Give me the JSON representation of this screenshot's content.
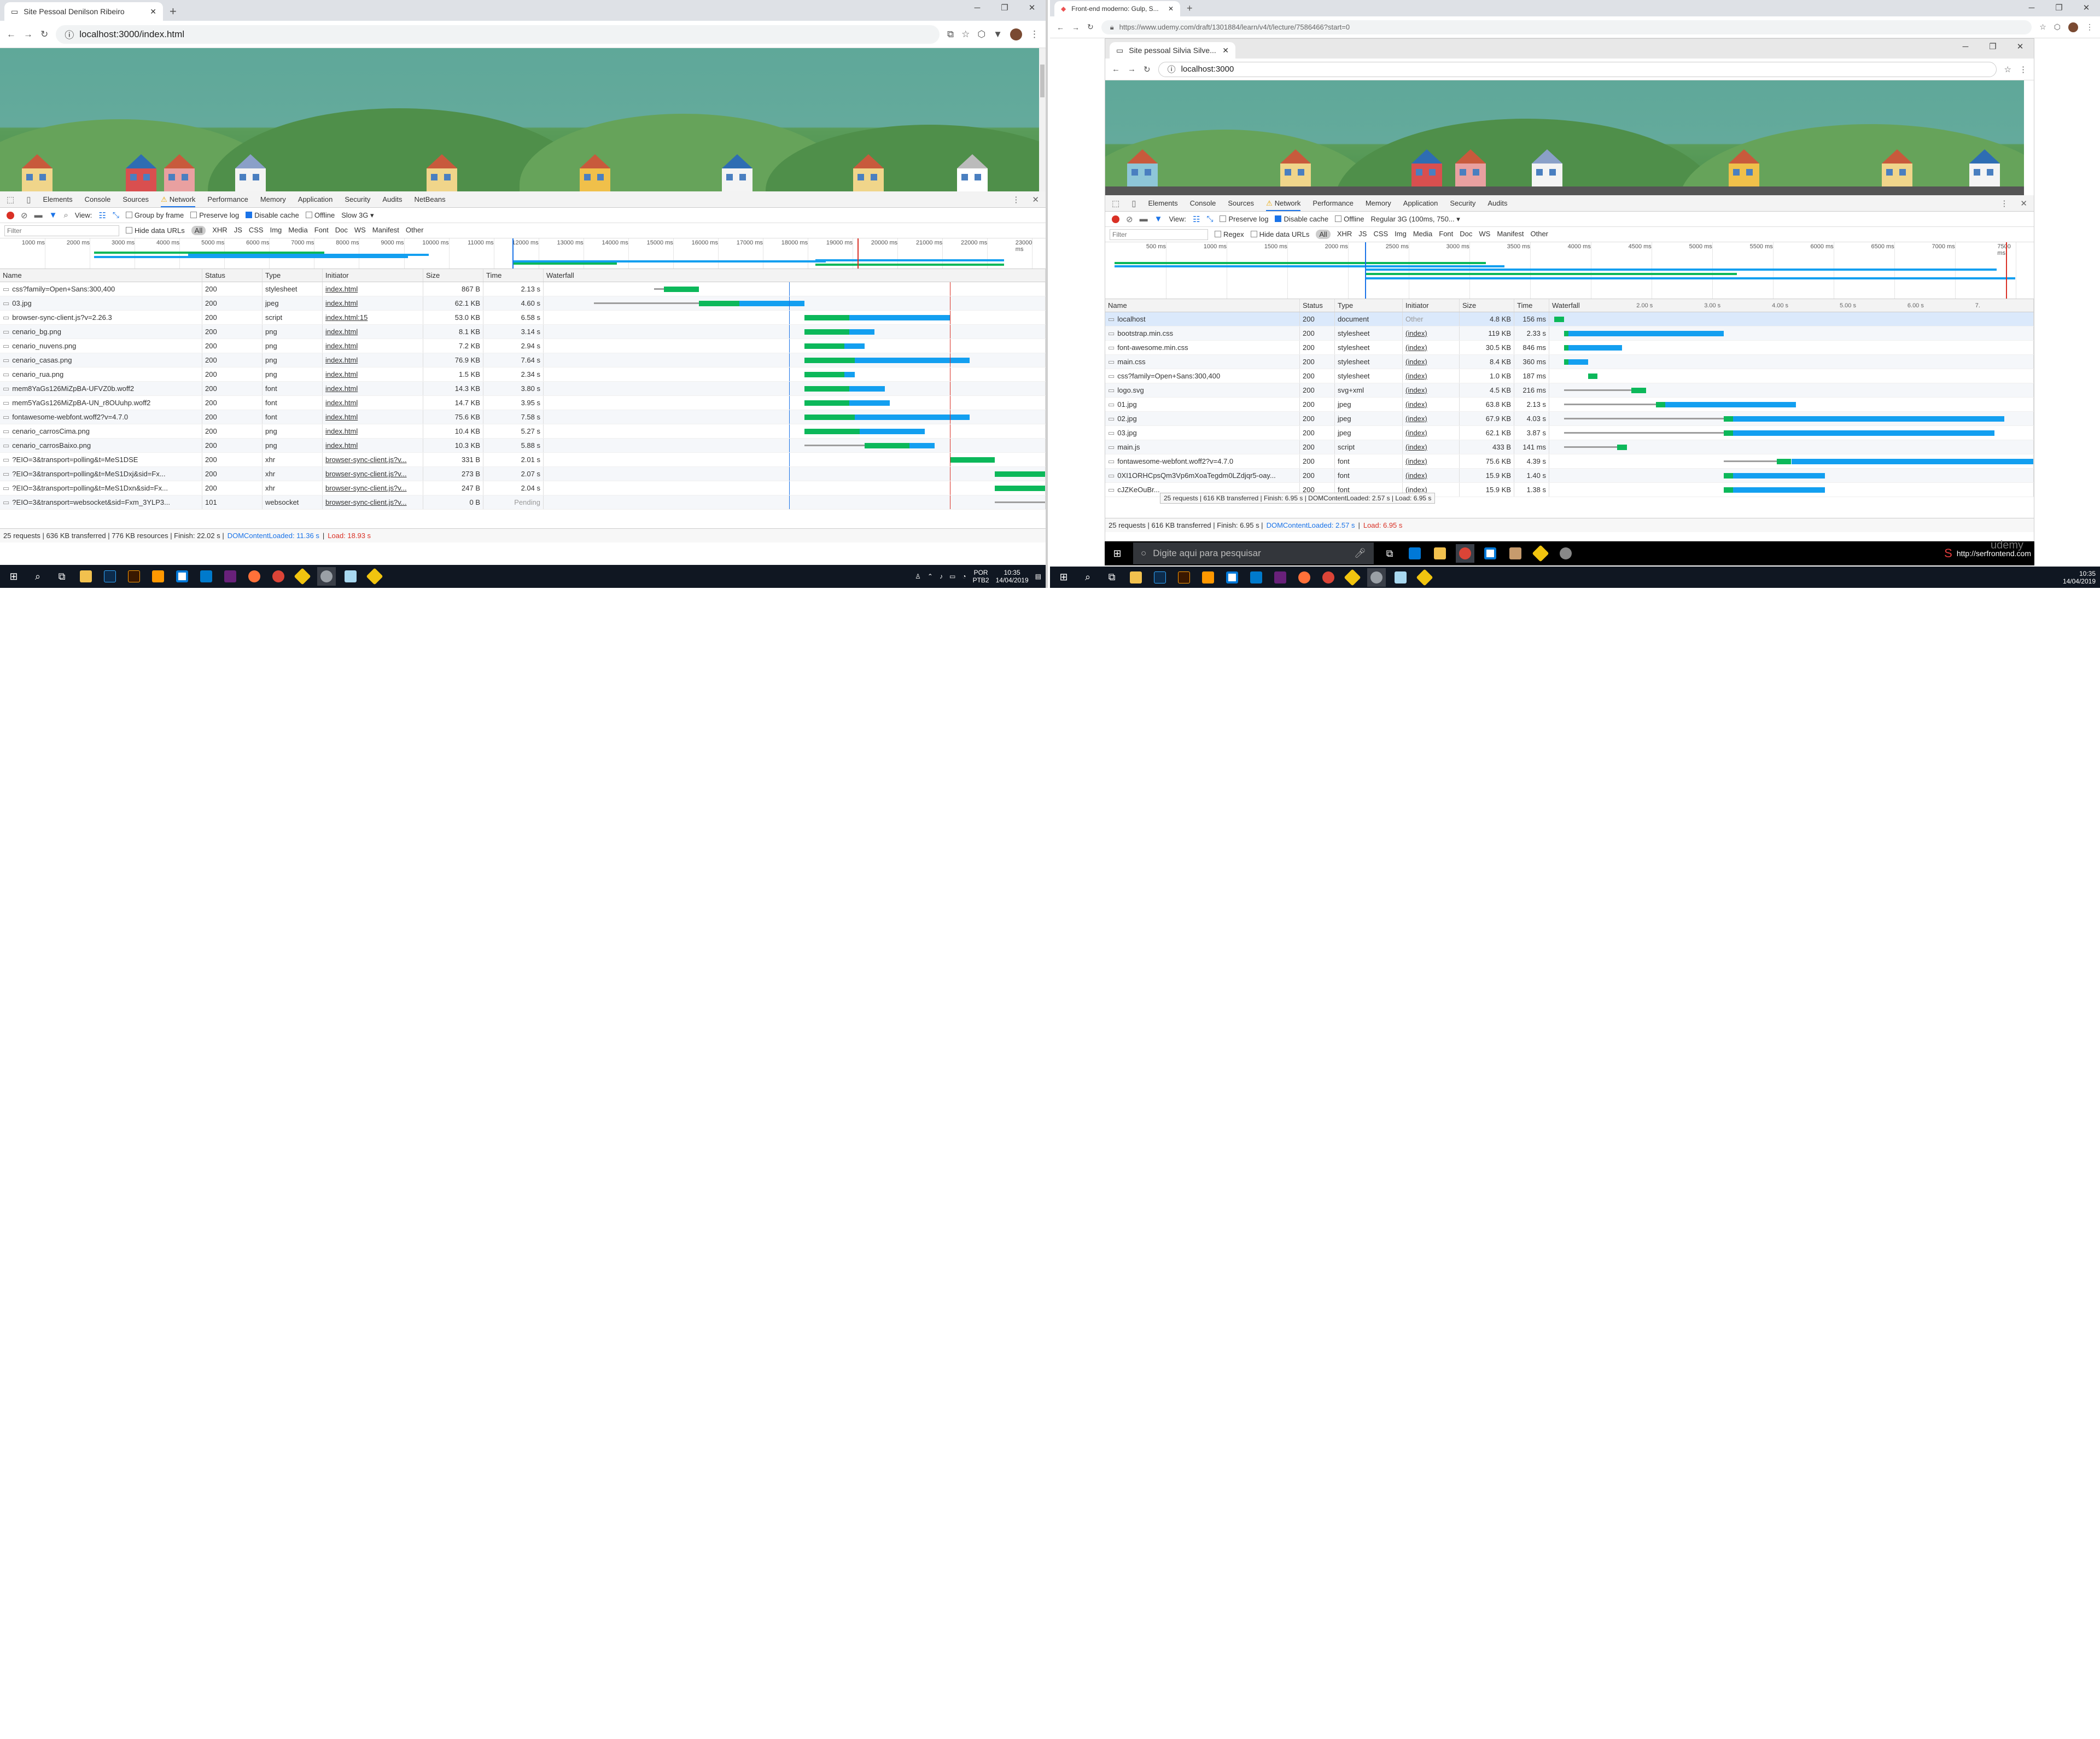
{
  "left": {
    "tab_title": "Site Pessoal Denilson Ribeiro",
    "url": "localhost:3000/index.html",
    "devtools_tabs": [
      "Elements",
      "Console",
      "Sources",
      "Network",
      "Performance",
      "Memory",
      "Application",
      "Security",
      "Audits",
      "NetBeans"
    ],
    "toolbar": {
      "view": "View:",
      "group_by_frame": "Group by frame",
      "preserve_log": "Preserve log",
      "disable_cache": "Disable cache",
      "offline": "Offline",
      "throttle": "Slow 3G"
    },
    "filter": {
      "placeholder": "Filter",
      "hide_data_urls": "Hide data URLs",
      "types": [
        "All",
        "XHR",
        "JS",
        "CSS",
        "Img",
        "Media",
        "Font",
        "Doc",
        "WS",
        "Manifest",
        "Other"
      ]
    },
    "overview_ticks": [
      "1000 ms",
      "2000 ms",
      "3000 ms",
      "4000 ms",
      "5000 ms",
      "6000 ms",
      "7000 ms",
      "8000 ms",
      "9000 ms",
      "10000 ms",
      "11000 ms",
      "12000 ms",
      "13000 ms",
      "14000 ms",
      "15000 ms",
      "16000 ms",
      "17000 ms",
      "18000 ms",
      "19000 ms",
      "20000 ms",
      "21000 ms",
      "22000 ms",
      "23000 ms"
    ],
    "columns": [
      "Name",
      "Status",
      "Type",
      "Initiator",
      "Size",
      "Time",
      "Waterfall"
    ],
    "rows": [
      {
        "name": "css?family=Open+Sans:300,400",
        "status": "200",
        "type": "stylesheet",
        "initiator": "index.html",
        "size": "867 B",
        "time": "2.13 s",
        "wf": [
          [
            0.22,
            0.24,
            0.31
          ]
        ]
      },
      {
        "name": "03.jpg",
        "status": "200",
        "type": "jpeg",
        "initiator": "index.html",
        "size": "62.1 KB",
        "time": "4.60 s",
        "wf": [
          [
            0.1,
            0.31,
            0.39,
            0.52
          ]
        ]
      },
      {
        "name": "browser-sync-client.js?v=2.26.3",
        "status": "200",
        "type": "script",
        "initiator": "index.html:15",
        "size": "53.0 KB",
        "time": "6.58 s",
        "wf": [
          [
            0.52,
            0.52,
            0.61,
            0.81
          ]
        ]
      },
      {
        "name": "cenario_bg.png",
        "status": "200",
        "type": "png",
        "initiator": "index.html",
        "size": "8.1 KB",
        "time": "3.14 s",
        "wf": [
          [
            0.52,
            0.52,
            0.61,
            0.66
          ]
        ]
      },
      {
        "name": "cenario_nuvens.png",
        "status": "200",
        "type": "png",
        "initiator": "index.html",
        "size": "7.2 KB",
        "time": "2.94 s",
        "wf": [
          [
            0.52,
            0.52,
            0.6,
            0.64
          ]
        ]
      },
      {
        "name": "cenario_casas.png",
        "status": "200",
        "type": "png",
        "initiator": "index.html",
        "size": "76.9 KB",
        "time": "7.64 s",
        "wf": [
          [
            0.52,
            0.52,
            0.62,
            0.85
          ]
        ]
      },
      {
        "name": "cenario_rua.png",
        "status": "200",
        "type": "png",
        "initiator": "index.html",
        "size": "1.5 KB",
        "time": "2.34 s",
        "wf": [
          [
            0.52,
            0.52,
            0.6,
            0.62
          ]
        ]
      },
      {
        "name": "mem8YaGs126MiZpBA-UFVZ0b.woff2",
        "status": "200",
        "type": "font",
        "initiator": "index.html",
        "size": "14.3 KB",
        "time": "3.80 s",
        "wf": [
          [
            0.52,
            0.52,
            0.61,
            0.68
          ]
        ]
      },
      {
        "name": "mem5YaGs126MiZpBA-UN_r8OUuhp.woff2",
        "status": "200",
        "type": "font",
        "initiator": "index.html",
        "size": "14.7 KB",
        "time": "3.95 s",
        "wf": [
          [
            0.52,
            0.52,
            0.61,
            0.69
          ]
        ]
      },
      {
        "name": "fontawesome-webfont.woff2?v=4.7.0",
        "status": "200",
        "type": "font",
        "initiator": "index.html",
        "size": "75.6 KB",
        "time": "7.58 s",
        "wf": [
          [
            0.52,
            0.52,
            0.62,
            0.85
          ]
        ]
      },
      {
        "name": "cenario_carrosCima.png",
        "status": "200",
        "type": "png",
        "initiator": "index.html",
        "size": "10.4 KB",
        "time": "5.27 s",
        "wf": [
          [
            0.52,
            0.52,
            0.63,
            0.76
          ]
        ]
      },
      {
        "name": "cenario_carrosBaixo.png",
        "status": "200",
        "type": "png",
        "initiator": "index.html",
        "size": "10.3 KB",
        "time": "5.88 s",
        "wf": [
          [
            0.52,
            0.64,
            0.73,
            0.78
          ]
        ]
      },
      {
        "name": "?EIO=3&transport=polling&t=MeS1DSE",
        "status": "200",
        "type": "xhr",
        "initiator": "browser-sync-client.js?v...",
        "size": "331 B",
        "time": "2.01 s",
        "wf": [
          [
            0.81,
            0.81,
            0.9,
            0.9
          ]
        ]
      },
      {
        "name": "?EIO=3&transport=polling&t=MeS1Dxj&sid=Fx...",
        "status": "200",
        "type": "xhr",
        "initiator": "browser-sync-client.js?v...",
        "size": "273 B",
        "time": "2.07 s",
        "wf": [
          [
            0.9,
            0.9,
            1.0,
            1.0
          ]
        ]
      },
      {
        "name": "?EIO=3&transport=polling&t=MeS1Dxn&sid=Fx...",
        "status": "200",
        "type": "xhr",
        "initiator": "browser-sync-client.js?v...",
        "size": "247 B",
        "time": "2.04 s",
        "wf": [
          [
            0.9,
            0.9,
            1.0,
            1.0
          ]
        ]
      },
      {
        "name": "?EIO=3&transport=websocket&sid=Fxm_3YLP3...",
        "status": "101",
        "type": "websocket",
        "initiator": "browser-sync-client.js?v...",
        "size": "0 B",
        "time": "Pending",
        "wf": [
          [
            0.9,
            1.0,
            1.0,
            1.0
          ]
        ]
      }
    ],
    "summary": "25 requests | 636 KB transferred | 776 KB resources | Finish: 22.02 s |",
    "dcl": "DOMContentLoaded: 11.36 s",
    "load": "Load: 18.93 s",
    "taskbar": {
      "lang": "POR\nPTB2",
      "time": "10:35",
      "date": "14/04/2019"
    }
  },
  "right": {
    "outer_tab": "Front-end moderno: Gulp, S...",
    "outer_url": "https://www.udemy.com/draft/1301884/learn/v4/t/lecture/7586466?start=0",
    "inner_tab": "Site pessoal Silvia Silve...",
    "inner_url": "localhost:3000",
    "devtools_tabs": [
      "Elements",
      "Console",
      "Sources",
      "Network",
      "Performance",
      "Memory",
      "Application",
      "Security",
      "Audits"
    ],
    "toolbar": {
      "view": "View:",
      "preserve_log": "Preserve log",
      "disable_cache": "Disable cache",
      "offline": "Offline",
      "throttle": "Regular 3G (100ms, 750..."
    },
    "filter": {
      "placeholder": "Filter",
      "regex": "Regex",
      "hide_data_urls": "Hide data URLs",
      "types": [
        "All",
        "XHR",
        "JS",
        "CSS",
        "Img",
        "Media",
        "Font",
        "Doc",
        "WS",
        "Manifest",
        "Other"
      ]
    },
    "overview_ticks": [
      "500 ms",
      "1000 ms",
      "1500 ms",
      "2000 ms",
      "2500 ms",
      "3000 ms",
      "3500 ms",
      "4000 ms",
      "4500 ms",
      "5000 ms",
      "5500 ms",
      "6000 ms",
      "6500 ms",
      "7000 ms",
      "7500 ms"
    ],
    "columns": [
      "Name",
      "Status",
      "Type",
      "Initiator",
      "Size",
      "Time",
      "Waterfall"
    ],
    "wf_ticks": [
      "2.00 s",
      "3.00 s",
      "4.00 s",
      "5.00 s",
      "6.00 s",
      "7."
    ],
    "rows": [
      {
        "name": "localhost",
        "status": "200",
        "type": "document",
        "initiator": "Other",
        "size": "4.8 KB",
        "time": "156 ms",
        "wf": [
          [
            0.01,
            0.01,
            0.03,
            0.03
          ]
        ]
      },
      {
        "name": "bootstrap.min.css",
        "status": "200",
        "type": "stylesheet",
        "initiator": "(index)",
        "size": "119 KB",
        "time": "2.33 s",
        "wf": [
          [
            0.03,
            0.03,
            0.04,
            0.36
          ]
        ]
      },
      {
        "name": "font-awesome.min.css",
        "status": "200",
        "type": "stylesheet",
        "initiator": "(index)",
        "size": "30.5 KB",
        "time": "846 ms",
        "wf": [
          [
            0.03,
            0.03,
            0.04,
            0.15
          ]
        ]
      },
      {
        "name": "main.css",
        "status": "200",
        "type": "stylesheet",
        "initiator": "(index)",
        "size": "8.4 KB",
        "time": "360 ms",
        "wf": [
          [
            0.03,
            0.03,
            0.04,
            0.08
          ]
        ]
      },
      {
        "name": "css?family=Open+Sans:300,400",
        "status": "200",
        "type": "stylesheet",
        "initiator": "(index)",
        "size": "1.0 KB",
        "time": "187 ms",
        "wf": [
          [
            0.08,
            0.08,
            0.1,
            0.1
          ]
        ]
      },
      {
        "name": "logo.svg",
        "status": "200",
        "type": "svg+xml",
        "initiator": "(index)",
        "size": "4.5 KB",
        "time": "216 ms",
        "wf": [
          [
            0.03,
            0.17,
            0.2,
            0.2
          ]
        ]
      },
      {
        "name": "01.jpg",
        "status": "200",
        "type": "jpeg",
        "initiator": "(index)",
        "size": "63.8 KB",
        "time": "2.13 s",
        "wf": [
          [
            0.03,
            0.22,
            0.24,
            0.51
          ]
        ]
      },
      {
        "name": "02.jpg",
        "status": "200",
        "type": "jpeg",
        "initiator": "(index)",
        "size": "67.9 KB",
        "time": "4.03 s",
        "wf": [
          [
            0.03,
            0.36,
            0.38,
            0.94
          ]
        ]
      },
      {
        "name": "03.jpg",
        "status": "200",
        "type": "jpeg",
        "initiator": "(index)",
        "size": "62.1 KB",
        "time": "3.87 s",
        "wf": [
          [
            0.03,
            0.36,
            0.38,
            0.92
          ]
        ]
      },
      {
        "name": "main.js",
        "status": "200",
        "type": "script",
        "initiator": "(index)",
        "size": "433 B",
        "time": "141 ms",
        "wf": [
          [
            0.03,
            0.14,
            0.16,
            0.16
          ]
        ]
      },
      {
        "name": "fontawesome-webfont.woff2?v=4.7.0",
        "status": "200",
        "type": "font",
        "initiator": "(index)",
        "size": "75.6 KB",
        "time": "4.39 s",
        "wf": [
          [
            0.36,
            0.47,
            0.5,
            1.0
          ]
        ]
      },
      {
        "name": "0XI1ORHCpsQm3Vp6mXoaTegdm0LZdjqr5-oay...",
        "status": "200",
        "type": "font",
        "initiator": "(index)",
        "size": "15.9 KB",
        "time": "1.40 s",
        "wf": [
          [
            0.36,
            0.36,
            0.38,
            0.57
          ]
        ]
      },
      {
        "name": "cJZKeOuBr...",
        "status": "200",
        "type": "font",
        "initiator": "(index)",
        "size": "15.9 KB",
        "time": "1.38 s",
        "wf": [
          [
            0.36,
            0.36,
            0.38,
            0.57
          ]
        ]
      }
    ],
    "tooltip": "25 requests | 616 KB transferred | Finish: 6.95 s | DOMContentLoaded: 2.57 s | Load: 6.95 s",
    "summary": "25 requests | 616 KB transferred | Finish: 6.95 s |",
    "dcl": "DOMContentLoaded: 2.57 s",
    "load": "Load: 6.95 s",
    "search_placeholder": "Digite aqui para pesquisar",
    "watermark_url": "http://serfrontend.com",
    "watermark_brand": "udemy",
    "taskbar": {
      "time": "10:35",
      "date": "14/04/2019"
    }
  }
}
